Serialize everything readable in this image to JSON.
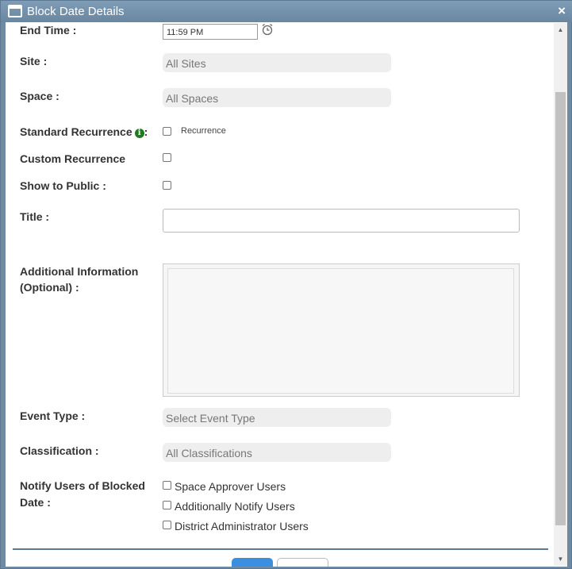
{
  "dialog": {
    "title": "Block Date Details",
    "close": "×"
  },
  "form": {
    "end_time": {
      "label": "End Time :",
      "value": "11:59 PM"
    },
    "site": {
      "label": "Site :",
      "value": "All Sites"
    },
    "space": {
      "label": "Space :",
      "value": "All Spaces"
    },
    "standard_recurrence": {
      "label": "Standard Recurrence",
      "colon": ":",
      "option": "Recurrence"
    },
    "custom_recurrence": {
      "label": "Custom Recurrence"
    },
    "show_to_public": {
      "label": "Show to Public :"
    },
    "title": {
      "label": "Title :",
      "value": ""
    },
    "additional_info": {
      "label_line1": "Additional Information",
      "label_line2": "(Optional) :"
    },
    "event_type": {
      "label": "Event Type :",
      "value": "Select Event Type"
    },
    "classification": {
      "label": "Classification :",
      "value": "All Classifications"
    },
    "notify": {
      "label_line1": "Notify Users of Blocked",
      "label_line2": "Date :",
      "options": [
        "Space Approver Users",
        "Additionally Notify Users",
        "District Administrator Users"
      ]
    }
  },
  "colors": {
    "titlebar": "#6f8aa3",
    "info": "#1f7a1f",
    "primary": "#3b8fe0"
  }
}
